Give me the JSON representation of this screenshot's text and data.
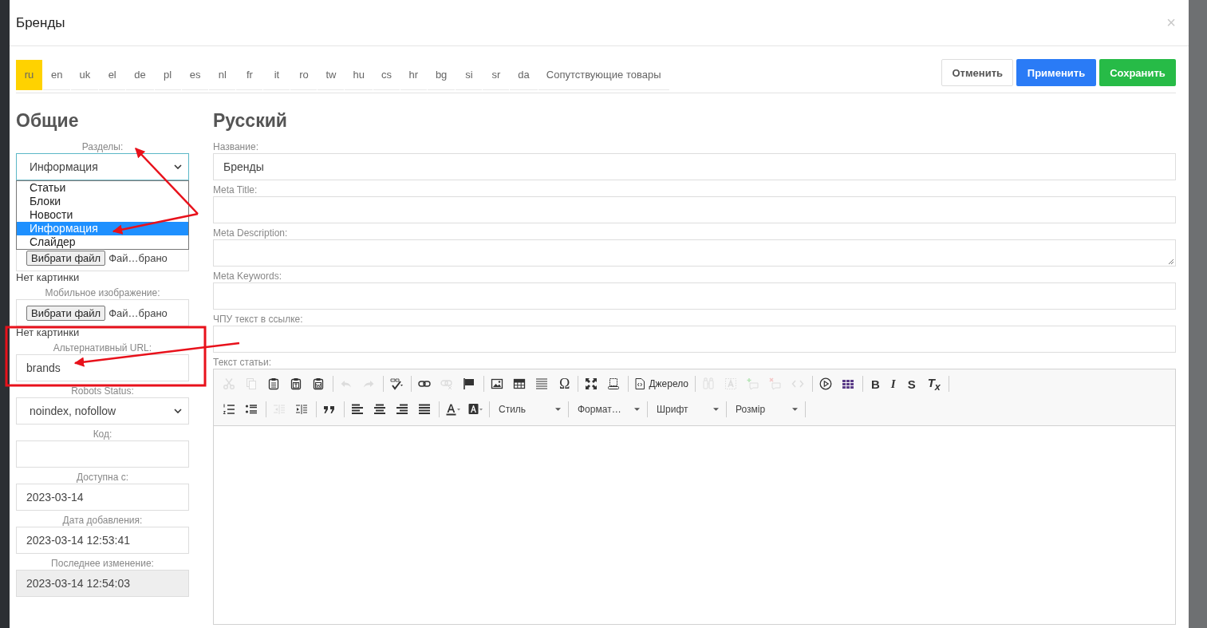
{
  "modal": {
    "title": "Бренды",
    "close": "×"
  },
  "tabs": [
    {
      "label": "ru",
      "selected": true
    },
    {
      "label": "en",
      "selected": false
    },
    {
      "label": "uk",
      "selected": false
    },
    {
      "label": "el",
      "selected": false
    },
    {
      "label": "de",
      "selected": false
    },
    {
      "label": "pl",
      "selected": false
    },
    {
      "label": "es",
      "selected": false
    },
    {
      "label": "nl",
      "selected": false
    },
    {
      "label": "fr",
      "selected": false
    },
    {
      "label": "it",
      "selected": false
    },
    {
      "label": "ro",
      "selected": false
    },
    {
      "label": "tw",
      "selected": false
    },
    {
      "label": "hu",
      "selected": false
    },
    {
      "label": "cs",
      "selected": false
    },
    {
      "label": "hr",
      "selected": false
    },
    {
      "label": "bg",
      "selected": false
    },
    {
      "label": "si",
      "selected": false
    },
    {
      "label": "sr",
      "selected": false
    },
    {
      "label": "da",
      "selected": false
    },
    {
      "label": "Сопутствующие товары",
      "selected": false
    }
  ],
  "buttons": [
    {
      "label": "Отменить",
      "kind": "cancel"
    },
    {
      "label": "Применить",
      "kind": "apply"
    },
    {
      "label": "Сохранить",
      "kind": "save"
    }
  ],
  "general": {
    "heading": "Общие",
    "fields": [
      {
        "kind": "select",
        "label": "Разделы:",
        "value": "Информация",
        "focused": true,
        "expanded": true,
        "options": [
          {
            "label": "Статьи",
            "selected": false
          },
          {
            "label": "Блоки",
            "selected": false
          },
          {
            "label": "Новости",
            "selected": false
          },
          {
            "label": "Информация",
            "selected": true
          },
          {
            "label": "Слайдер",
            "selected": false
          }
        ]
      },
      {
        "kind": "file",
        "button": "Вибрати файл",
        "value": "Фай…брано"
      },
      {
        "kind": "note",
        "value": "Нет картинки"
      },
      {
        "kind": "file",
        "label": "Мобильное изображение:",
        "button": "Вибрати файл",
        "value": "Фай…брано"
      },
      {
        "kind": "note",
        "value": "Нет картинки"
      },
      {
        "kind": "input",
        "label": "Альтернативный URL:",
        "value": "brands"
      },
      {
        "kind": "select",
        "label": "Robots Status:",
        "value": "noindex, nofollow",
        "focused": false
      },
      {
        "kind": "input",
        "label": "Код:"
      },
      {
        "kind": "input",
        "label": "Доступна с:",
        "value": "2023-03-14"
      },
      {
        "kind": "input",
        "label": "Дата добавления:",
        "value": "2023-03-14 12:53:41"
      },
      {
        "kind": "input",
        "label": "Последнее изменение:",
        "value": "2023-03-14 12:54:03",
        "disabled": true
      }
    ]
  },
  "russian": {
    "heading": "Русский",
    "fields": [
      {
        "kind": "input",
        "label": "Название:",
        "value": "Бренды"
      },
      {
        "kind": "input",
        "label": "Meta Title:"
      },
      {
        "kind": "textarea",
        "label": "Meta Description:"
      },
      {
        "kind": "input",
        "label": "Meta Keywords:"
      },
      {
        "kind": "input",
        "label": "ЧПУ текст в ссылке:"
      },
      {
        "kind": "editor",
        "label": "Текст статьи:",
        "toolbar": [
          [
            {
              "kind": "icon",
              "disabled": true
            },
            {
              "kind": "icon",
              "disabled": true
            },
            {
              "kind": "icon",
              "disabled": false
            },
            {
              "kind": "icon",
              "disabled": false
            },
            {
              "kind": "icon",
              "disabled": false
            },
            {
              "kind": "sep"
            },
            {
              "kind": "icon",
              "disabled": true
            },
            {
              "kind": "icon",
              "disabled": true
            },
            {
              "kind": "sep"
            },
            {
              "kind": "icon",
              "disabled": false
            },
            {
              "kind": "sep"
            },
            {
              "kind": "icon",
              "disabled": false
            },
            {
              "kind": "icon",
              "disabled": true
            },
            {
              "kind": "icon",
              "disabled": false
            },
            {
              "kind": "sep"
            },
            {
              "kind": "icon",
              "disabled": false
            },
            {
              "kind": "icon",
              "disabled": false
            },
            {
              "kind": "icon",
              "disabled": false
            },
            {
              "kind": "char",
              "label": "Ω"
            },
            {
              "kind": "sep"
            },
            {
              "kind": "icon",
              "disabled": false
            },
            {
              "kind": "icon",
              "disabled": false
            },
            {
              "kind": "sep"
            },
            {
              "kind": "source",
              "label": "Джерело"
            },
            {
              "kind": "sep"
            },
            {
              "kind": "icon",
              "disabled": true
            },
            {
              "kind": "icon",
              "disabled": true
            },
            {
              "kind": "icon",
              "disabled": true
            },
            {
              "kind": "icon",
              "disabled": true
            },
            {
              "kind": "icon",
              "disabled": true
            },
            {
              "kind": "sep"
            },
            {
              "kind": "icon",
              "disabled": false
            },
            {
              "kind": "icon",
              "disabled": false
            },
            {
              "kind": "sep"
            },
            {
              "kind": "bold",
              "label": "B"
            },
            {
              "kind": "italic",
              "label": "I"
            },
            {
              "kind": "strike",
              "label": "S"
            },
            {
              "kind": "clear",
              "label": "T$_{x}$"
            },
            {
              "kind": "sep"
            }
          ],
          [
            {
              "kind": "icon",
              "disabled": false
            },
            {
              "kind": "icon",
              "disabled": false
            },
            {
              "kind": "sep"
            },
            {
              "kind": "icon",
              "disabled": true
            },
            {
              "kind": "icon",
              "disabled": false
            },
            {
              "kind": "sep"
            },
            {
              "kind": "icon",
              "disabled": false
            },
            {
              "kind": "sep"
            },
            {
              "kind": "icon",
              "disabled": false
            },
            {
              "kind": "icon",
              "disabled": false
            },
            {
              "kind": "icon",
              "disabled": false
            },
            {
              "kind": "icon",
              "disabled": false
            },
            {
              "kind": "sep"
            },
            {
              "kind": "icon",
              "disabled": false
            },
            {
              "kind": "icon",
              "disabled": false
            },
            {
              "kind": "sep"
            },
            {
              "kind": "combo",
              "label": "Стиль"
            },
            {
              "kind": "sep"
            },
            {
              "kind": "combo",
              "label": "Формат…"
            },
            {
              "kind": "sep"
            },
            {
              "kind": "combo",
              "label": "Шрифт"
            },
            {
              "kind": "sep"
            },
            {
              "kind": "combo",
              "label": "Розмір"
            },
            {
              "kind": "sep"
            }
          ]
        ]
      }
    ]
  }
}
